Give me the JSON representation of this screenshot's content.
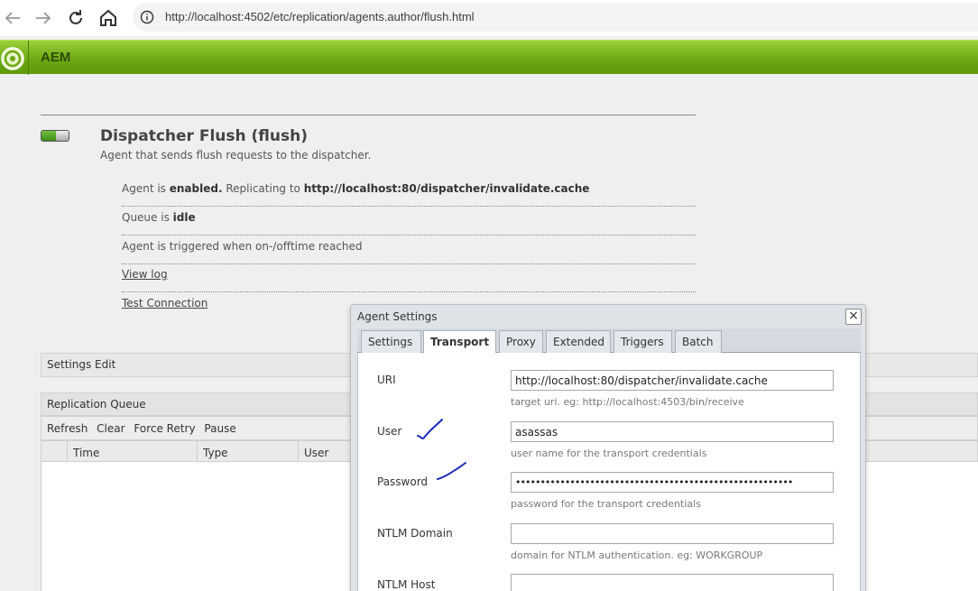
{
  "browser": {
    "url": "http://localhost:4502/etc/replication/agents.author/flush.html"
  },
  "header": {
    "title": "AEM"
  },
  "agent": {
    "title": "Dispatcher Flush (flush)",
    "description": "Agent that sends flush requests to the dispatcher.",
    "status_prefix": "Agent is",
    "status_value": "enabled.",
    "replicating_prefix": "Replicating to",
    "replicating_uri": "http://localhost:80/dispatcher/invalidate.cache",
    "queue_prefix": "Queue is",
    "queue_value": "idle",
    "trigger_text": "Agent is triggered when on-/offtime reached",
    "view_log": "View log",
    "test_connection": "Test Connection"
  },
  "settings_bar": {
    "label": "Settings",
    "edit": "Edit"
  },
  "replication_queue": {
    "title": "Replication Queue",
    "toolbar": [
      "Refresh",
      "Clear",
      "Force Retry",
      "Pause"
    ],
    "columns": [
      "Time",
      "Type",
      "User"
    ]
  },
  "dialog": {
    "title": "Agent Settings",
    "close": "×",
    "tabs": [
      "Settings",
      "Transport",
      "Proxy",
      "Extended",
      "Triggers",
      "Batch"
    ],
    "active_tab": "Transport",
    "fields": [
      {
        "label": "URI",
        "value": "http://localhost:80/dispatcher/invalidate.cache",
        "hint": "target uri. eg: http://localhost:4503/bin/receive"
      },
      {
        "label": "User",
        "value": "asassas",
        "hint": "user name for the transport credentials"
      },
      {
        "label": "Password",
        "value": "••••••••••••••••••••••••••••••••••••••••••••••••••••••••",
        "hint": "password for the transport credentials"
      },
      {
        "label": "NTLM Domain",
        "value": "",
        "hint": "domain for NTLM authentication. eg: WORKGROUP"
      },
      {
        "label": "NTLM Host",
        "value": "",
        "hint": ""
      }
    ]
  },
  "colors": {
    "aem_green": "#6ba612",
    "annotation_blue": "#1a2bbd"
  }
}
